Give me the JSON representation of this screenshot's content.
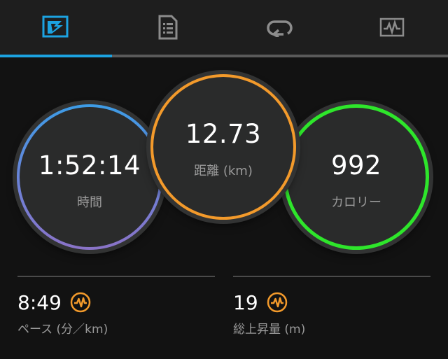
{
  "tabs": [
    {
      "name": "overview-tab",
      "icon": "summary-flag-icon",
      "active": true
    },
    {
      "name": "details-tab",
      "icon": "document-list-icon",
      "active": false
    },
    {
      "name": "laps-tab",
      "icon": "loop-arrow-icon",
      "active": false
    },
    {
      "name": "charts-tab",
      "icon": "heart-rate-chart-icon",
      "active": false
    }
  ],
  "colors": {
    "active_tab": "#1ca3e1",
    "time_ring": "#3d9ce6",
    "time_ring_end": "#8a73c7",
    "distance_ring": "#f39a2b",
    "calories_ring": "#2ee62b",
    "perf_icon": "#f39a2b"
  },
  "stats": {
    "time": {
      "value": "1:52:14",
      "label": "時間"
    },
    "distance": {
      "value": "12.73",
      "label": "距離 (km)"
    },
    "calories": {
      "value": "992",
      "label": "カロリー"
    }
  },
  "metrics": {
    "pace": {
      "value": "8:49",
      "label": "ペース (分／km)",
      "icon": "performance-wave-icon"
    },
    "elevation": {
      "value": "19",
      "label": "総上昇量 (m)",
      "icon": "performance-wave-icon"
    }
  }
}
